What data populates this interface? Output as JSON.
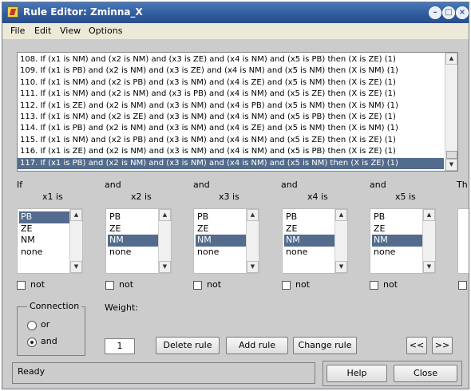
{
  "window": {
    "title": "Rule Editor: Zminna_X"
  },
  "menu": [
    "File",
    "Edit",
    "View",
    "Options"
  ],
  "rules": [
    "108. If (x1 is NM) and (x2 is NM) and (x3 is ZE) and (x4 is NM) and (x5 is PB) then (X is ZE) (1)",
    "109. If (x1 is PB) and (x2 is NM) and (x3 is ZE) and (x4 is NM) and (x5 is NM) then (X is NM) (1)",
    "110. If (x1 is NM) and (x2 is PB) and (x3 is NM) and (x4 is ZE) and (x5 is NM) then (X is ZE) (1)",
    "111. If (x1 is NM) and (x2 is NM) and (x3 is PB) and (x4 is NM) and (x5 is ZE) then (X is ZE) (1)",
    "112. If (x1 is ZE) and (x2 is NM) and (x3 is NM) and (x4 is PB) and (x5 is NM) then (X is NM) (1)",
    "113. If (x1 is NM) and (x2 is ZE) and (x3 is NM) and (x4 is NM) and (x5 is PB) then (X is ZE) (1)",
    "114. If (x1 is PB) and (x2 is NM) and (x3 is NM) and (x4 is ZE) and (x5 is NM) then (X is NM) (1)",
    "115. If (x1 is NM) and (x2 is PB) and (x3 is NM) and (x4 is NM) and (x5 is ZE) then (X is ZE) (1)",
    "116. If (x1 is ZE) and (x2 is NM) and (x3 is NM) and (x4 is NM) and (x5 is PB) then (X is ZE) (1)",
    "117. If (x1 is PB) and (x2 is NM) and (x3 is NM) and (x4 is NM) and (x5 is NM) then (X is ZE) (1)"
  ],
  "selected_rule_index": 9,
  "connectors": [
    "If",
    "and",
    "and",
    "and",
    "and",
    "Th"
  ],
  "variables": [
    {
      "name": "x1 is",
      "options": [
        "PB",
        "ZE",
        "NM",
        "none"
      ],
      "selected": "PB"
    },
    {
      "name": "x2 is",
      "options": [
        "PB",
        "ZE",
        "NM",
        "none"
      ],
      "selected": "NM"
    },
    {
      "name": "x3 is",
      "options": [
        "PB",
        "ZE",
        "NM",
        "none"
      ],
      "selected": "NM"
    },
    {
      "name": "x4 is",
      "options": [
        "PB",
        "ZE",
        "NM",
        "none"
      ],
      "selected": "NM"
    },
    {
      "name": "x5 is",
      "options": [
        "PB",
        "ZE",
        "NM",
        "none"
      ],
      "selected": "NM"
    }
  ],
  "not_label": "not",
  "connection": {
    "title": "Connection",
    "options": [
      "or",
      "and"
    ],
    "selected": "and"
  },
  "weight": {
    "label": "Weight:",
    "value": "1"
  },
  "buttons": {
    "delete": "Delete rule",
    "add": "Add rule",
    "change": "Change rule",
    "prev": "<<",
    "next": ">>",
    "help": "Help",
    "close": "Close"
  },
  "status": "Ready",
  "colors": {
    "titlebar": "#2f5a9c",
    "selection": "#536b8c",
    "background": "#cccccc"
  }
}
